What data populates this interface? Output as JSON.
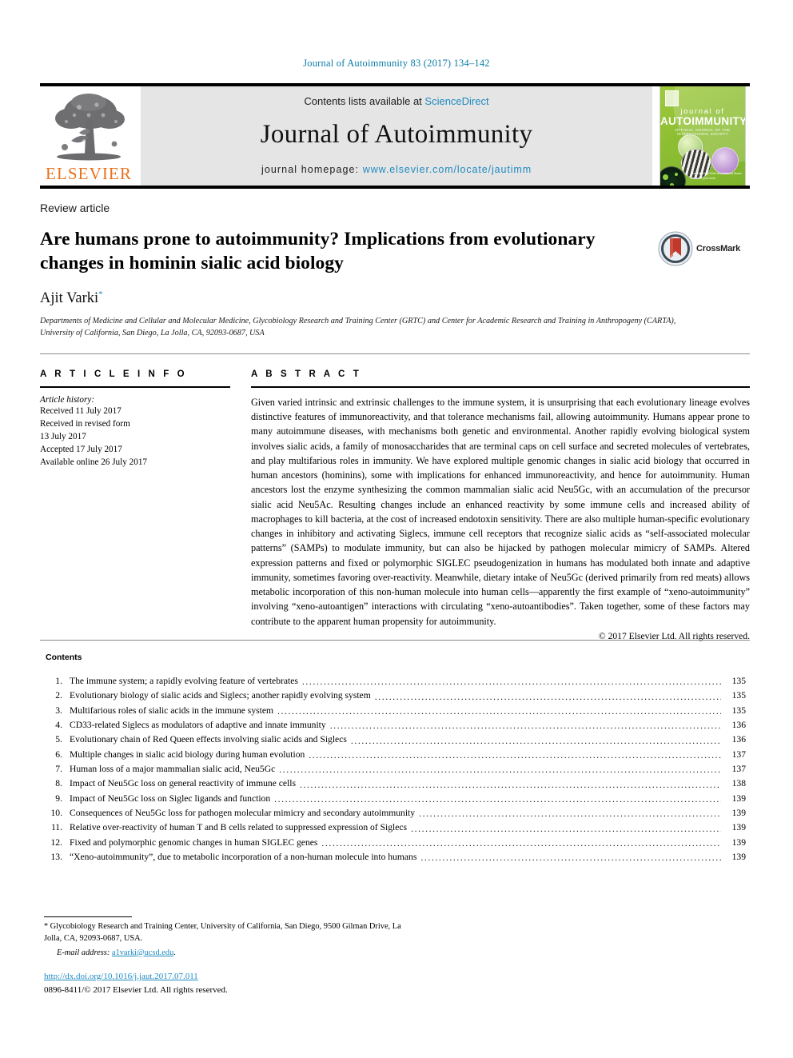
{
  "running_head": "Journal of Autoimmunity 83 (2017) 134–142",
  "masthead": {
    "publisher_wordmark": "ELSEVIER",
    "publisher_logo_icon": "elsevier-tree-icon",
    "contents_prefix": "Contents lists available at ",
    "contents_link": "ScienceDirect",
    "journal_name": "Journal of Autoimmunity",
    "homepage_prefix": "journal homepage: ",
    "homepage_url": "www.elsevier.com/locate/jautimm",
    "cover": {
      "line_small": "journal of",
      "line_big": "AUTOIMMUNITY",
      "line_sub": "OFFICIAL JOURNAL OF THE INTERNATIONAL SOCIETY",
      "credit": "The Editors-in-Chief\nand Editorial Board\nwelcome your work"
    },
    "colors": {
      "link": "#1f8ac0",
      "elsevier_orange": "#e9711c",
      "band_bg": "#e5e5e5",
      "cover_green": "#8dbe32"
    }
  },
  "article": {
    "category": "Review article",
    "title": "Are humans prone to autoimmunity? Implications from evolutionary changes in hominin sialic acid biology",
    "author": "Ajit Varki",
    "author_marker": "*",
    "affiliation": "Departments of Medicine and Cellular and Molecular Medicine, Glycobiology Research and Training Center (GRTC) and Center for Academic Research and Training in Anthropogeny (CARTA), University of California, San Diego, La Jolla, CA, 92093-0687, USA",
    "crossmark_label": "CrossMark"
  },
  "article_info": {
    "heading": "A R T I C L E   I N F O",
    "history_label": "Article history:",
    "history": [
      "Received 11 July 2017",
      "Received in revised form",
      "13 July 2017",
      "Accepted 17 July 2017",
      "Available online 26 July 2017"
    ]
  },
  "abstract": {
    "heading": "A B S T R A C T",
    "text": "Given varied intrinsic and extrinsic challenges to the immune system, it is unsurprising that each evolutionary lineage evolves distinctive features of immunoreactivity, and that tolerance mechanisms fail, allowing autoimmunity. Humans appear prone to many autoimmune diseases, with mechanisms both genetic and environmental. Another rapidly evolving biological system involves sialic acids, a family of monosaccharides that are terminal caps on cell surface and secreted molecules of vertebrates, and play multifarious roles in immunity. We have explored multiple genomic changes in sialic acid biology that occurred in human ancestors (hominins), some with implications for enhanced immunoreactivity, and hence for autoimmunity. Human ancestors lost the enzyme synthesizing the common mammalian sialic acid Neu5Gc, with an accumulation of the precursor sialic acid Neu5Ac. Resulting changes include an enhanced reactivity by some immune cells and increased ability of macrophages to kill bacteria, at the cost of increased endotoxin sensitivity. There are also multiple human-specific evolutionary changes in inhibitory and activating Siglecs, immune cell receptors that recognize sialic acids as “self-associated molecular patterns” (SAMPs) to modulate immunity, but can also be hijacked by pathogen molecular mimicry of SAMPs. Altered expression patterns and fixed or polymorphic SIGLEC pseudogenization in humans has modulated both innate and adaptive immunity, sometimes favoring over-reactivity. Meanwhile, dietary intake of Neu5Gc (derived primarily from red meats) allows metabolic incorporation of this non-human molecule into human cells—apparently the first example of “xeno-autoimmunity” involving “xeno-autoantigen” interactions with circulating “xeno-autoantibodies”. Taken together, some of these factors may contribute to the apparent human propensity for autoimmunity.",
    "copyright": "© 2017 Elsevier Ltd. All rights reserved."
  },
  "contents": {
    "heading": "Contents",
    "items": [
      {
        "num": "1.",
        "label": "The immune system; a rapidly evolving feature of vertebrates",
        "page": "135"
      },
      {
        "num": "2.",
        "label": "Evolutionary biology of sialic acids and Siglecs; another rapidly evolving system",
        "page": "135"
      },
      {
        "num": "3.",
        "label": "Multifarious roles of sialic acids in the immune system",
        "page": "135"
      },
      {
        "num": "4.",
        "label": "CD33-related Siglecs as modulators of adaptive and innate immunity",
        "page": "136"
      },
      {
        "num": "5.",
        "label": "Evolutionary chain of Red Queen effects involving sialic acids and Siglecs",
        "page": "136"
      },
      {
        "num": "6.",
        "label": "Multiple changes in sialic acid biology during human evolution",
        "page": "137"
      },
      {
        "num": "7.",
        "label": "Human loss of a major mammalian sialic acid, Neu5Gc",
        "page": "137"
      },
      {
        "num": "8.",
        "label": "Impact of Neu5Gc loss on general reactivity of immune cells",
        "page": "138"
      },
      {
        "num": "9.",
        "label": "Impact of Neu5Gc loss on Siglec ligands and function",
        "page": "139"
      },
      {
        "num": "10.",
        "label": "Consequences of Neu5Gc loss for pathogen molecular mimicry and secondary autoimmunity",
        "page": "139"
      },
      {
        "num": "11.",
        "label": "Relative over-reactivity of human T and B cells related to suppressed expression of Siglecs",
        "page": "139"
      },
      {
        "num": "12.",
        "label": "Fixed and polymorphic genomic changes in human SIGLEC genes",
        "page": "139"
      },
      {
        "num": "13.",
        "label": "“Xeno-autoimmunity”, due to metabolic incorporation of a non-human molecule into humans",
        "page": "139"
      }
    ]
  },
  "footnotes": {
    "corresponding_marker": "*",
    "corresponding_line1": "Glycobiology Research and Training Center, University of California, San Diego,",
    "corresponding_line2": "9500 Gilman Drive, La Jolla, CA, 92093-0687, USA.",
    "email_label": "E-mail address:",
    "email": "a1varki@ucsd.edu",
    "email_suffix": ".",
    "doi": "http://dx.doi.org/10.1016/j.jaut.2017.07.011",
    "issn_line": "0896-8411/© 2017 Elsevier Ltd. All rights reserved."
  }
}
